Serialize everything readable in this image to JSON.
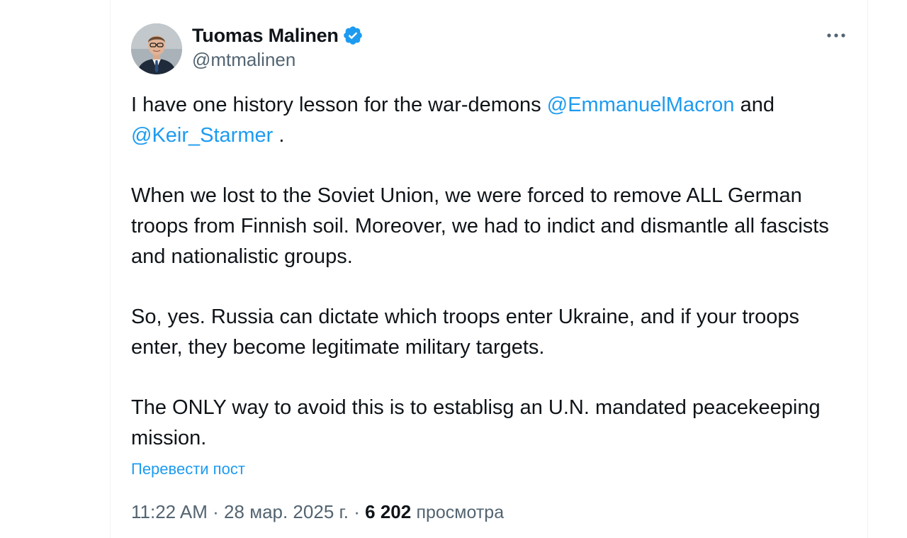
{
  "author": {
    "display_name": "Tuomas Malinen",
    "handle": "@mtmalinen",
    "verified": true
  },
  "tweet": {
    "paragraphs": [
      {
        "segments": [
          {
            "type": "text",
            "value": "I have one history lesson for the war-demons "
          },
          {
            "type": "mention",
            "value": "@EmmanuelMacron"
          },
          {
            "type": "text",
            "value": " and "
          },
          {
            "type": "mention",
            "value": "@Keir_Starmer"
          },
          {
            "type": "text",
            "value": " ."
          }
        ]
      },
      {
        "segments": [
          {
            "type": "text",
            "value": "When we lost to the Soviet Union, we were forced to remove ALL German troops from Finnish soil. Moreover, we had to indict and dismantle all fascists and nationalistic groups."
          }
        ]
      },
      {
        "segments": [
          {
            "type": "text",
            "value": "So, yes. Russia can dictate which troops enter Ukraine, and if your troops enter, they become legitimate military targets."
          }
        ]
      },
      {
        "segments": [
          {
            "type": "text",
            "value": "The ONLY way to avoid this is to establisg an U.N. mandated peacekeeping mission."
          }
        ]
      }
    ],
    "translate_label": "Перевести пост"
  },
  "meta": {
    "time": "11:22 AM",
    "separator": " · ",
    "date": "28 мар. 2025 г.",
    "views_count": "6 202",
    "views_label": "просмотра"
  },
  "icons": {
    "more": "more-horizontal-icon",
    "verified": "verified-badge-icon"
  },
  "colors": {
    "accent": "#1d9bf0",
    "text_primary": "#0f1419",
    "text_secondary": "#536471",
    "border": "#eff3f4"
  }
}
